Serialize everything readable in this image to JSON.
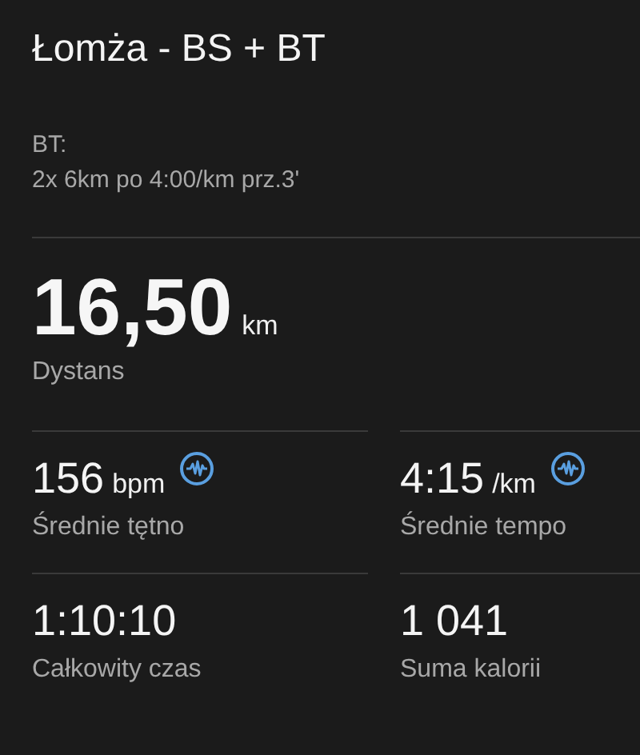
{
  "title": "Łomża - BS + BT",
  "description": [
    "BT:",
    "2x 6km po 4:00/km prz.3'"
  ],
  "main_stat": {
    "value": "16,50",
    "unit": "km",
    "label": "Dystans"
  },
  "stats": [
    {
      "value": "156",
      "unit": "bpm",
      "label": "Średnie tętno",
      "has_chart": true
    },
    {
      "value": "4:15",
      "unit": "/km",
      "label": "Średnie tempo",
      "has_chart": true
    },
    {
      "value": "1:10:10",
      "label": "Całkowity czas",
      "has_chart": false
    },
    {
      "value": "1 041",
      "label": "Suma kalorii",
      "has_chart": false
    }
  ]
}
